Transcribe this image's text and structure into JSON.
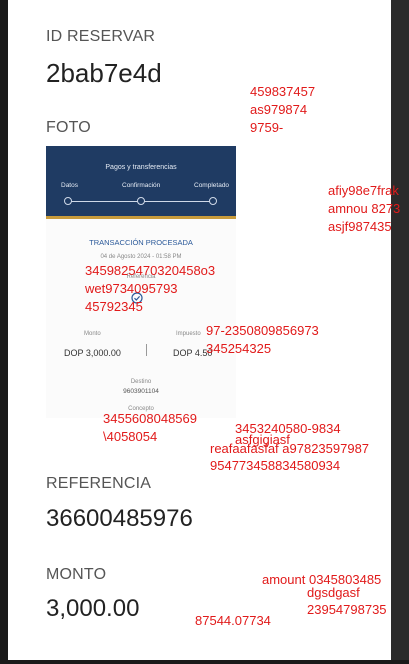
{
  "reservation": {
    "label": "ID RESERVAR",
    "value": "2bab7e4d"
  },
  "photo": {
    "label": "FOTO",
    "receipt": {
      "header_title": "Pagos y transferencias",
      "steps": [
        "Datos",
        "Confirmación",
        "Completado"
      ],
      "status_title": "TRANSACCIÓN PROCESADA",
      "date": "04 de Agosto 2024 - 01:58 PM",
      "reference_label": "Referencia",
      "amount_label": "Monto",
      "amount_value": "DOP 3,000.00",
      "tax_label": "Impuesto",
      "tax_value": "DOP 4.50",
      "destination_label": "Destino",
      "destination_value": "9603901104",
      "concept_label": "Concepto"
    }
  },
  "reference": {
    "label": "REFERENCIA",
    "value": "36600485976"
  },
  "amount": {
    "label": "MONTO",
    "value": "3,000.00"
  },
  "annotations": {
    "a1": "459837457",
    "a2": "as979874",
    "a3": "9759-",
    "b1": "afiy98e7frak",
    "b2": "amnou 8273",
    "b3": "asjf987435",
    "c1": "3459825470320458o3",
    "c2": "wet9734095793",
    "c3": "45792345",
    "d1": "97-2350809856973",
    "d2": "345254325",
    "e1": "3455608048569",
    "e2": "\\4058054",
    "f1": "3453240580-9834",
    "f2": "asfgigiasf",
    "f3": "reafaafasfaf a97823597987",
    "f4": "954773458834580934",
    "g1": "amount 0345803485",
    "g2": "dgsdgasf",
    "g3": "23954798735",
    "h1": "87544.07734"
  }
}
